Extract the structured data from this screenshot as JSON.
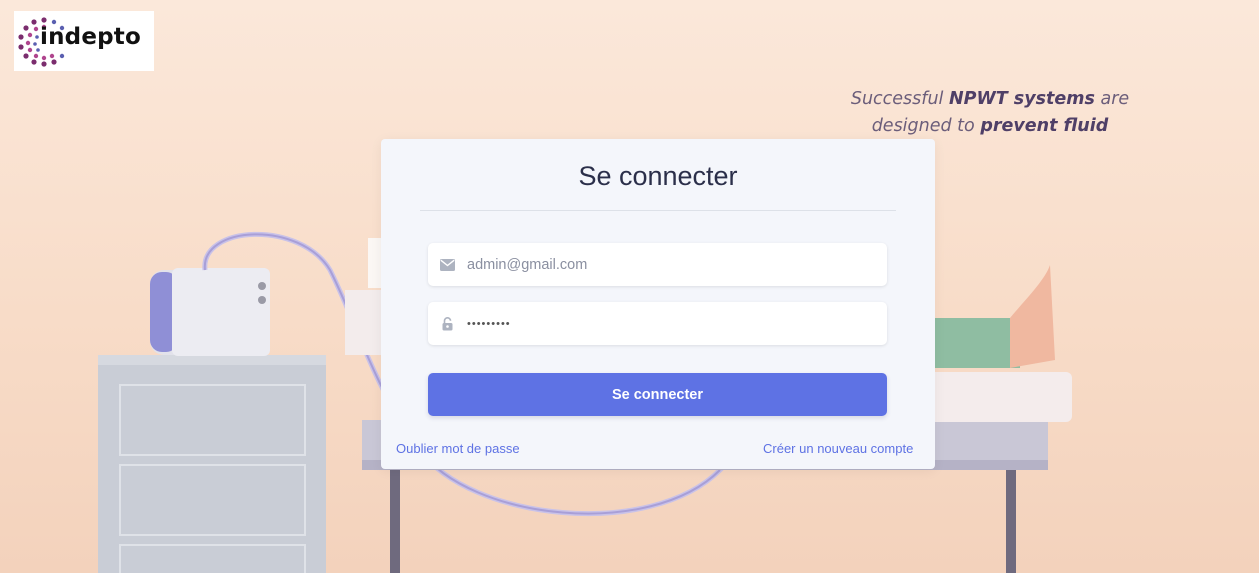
{
  "brand": {
    "logo_text": "indepto"
  },
  "tagline": {
    "line1_prefix": "Successful ",
    "line1_bold": "NPWT systems",
    "line1_suffix": " are",
    "line2_prefix": "designed to ",
    "line2_bold": "prevent fluid"
  },
  "login": {
    "title": "Se connecter",
    "email": {
      "value": "admin@gmail.com",
      "icon": "envelope-icon"
    },
    "password": {
      "value": "•••••••••",
      "icon": "lock-icon"
    },
    "submit_label": "Se connecter",
    "forgot_link": "Oublier mot de passe",
    "register_link": "Créer un nouveau compte"
  },
  "colors": {
    "accent": "#5e72e4",
    "title": "#2b2f4a"
  }
}
